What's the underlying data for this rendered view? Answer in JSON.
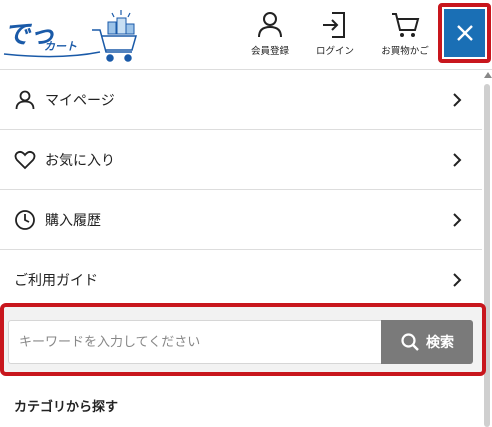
{
  "header": {
    "logo_text": "でっ",
    "logo_sub": "カート",
    "register_label": "会員登録",
    "login_label": "ログイン",
    "cart_label": "お買物かご",
    "close_icon": "close-icon"
  },
  "menu": {
    "items": [
      {
        "label": "マイページ",
        "icon": "person-icon"
      },
      {
        "label": "お気に入り",
        "icon": "heart-icon"
      },
      {
        "label": "購入履歴",
        "icon": "clock-icon"
      },
      {
        "label": "ご利用ガイド",
        "icon": ""
      }
    ]
  },
  "search": {
    "placeholder": "キーワードを入力してください",
    "value": "",
    "button_label": "検索"
  },
  "category": {
    "title": "カテゴリから探す"
  },
  "colors": {
    "brand_blue": "#1a6fb5",
    "highlight_red": "#c8161d",
    "search_button": "#7a7a7a"
  }
}
